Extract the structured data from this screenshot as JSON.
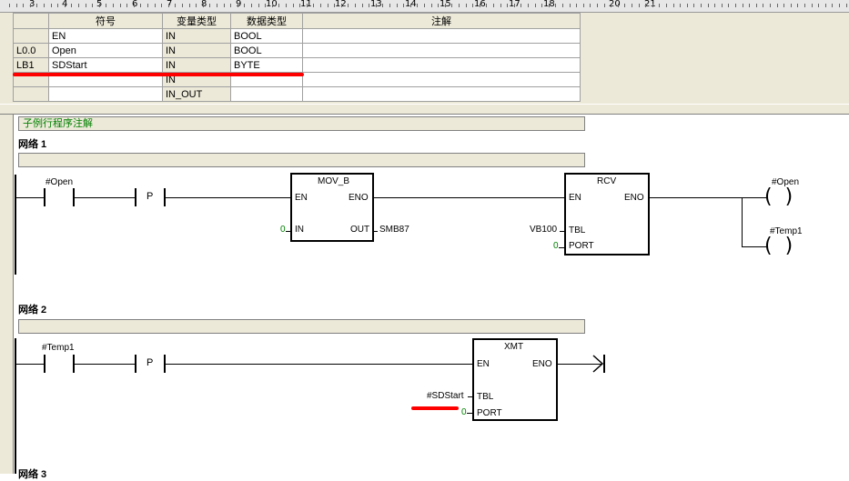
{
  "ruler": {
    "ticks": [
      "3",
      "4",
      "5",
      "6",
      "7",
      "8",
      "9",
      "10",
      "11",
      "12",
      "13",
      "14",
      "15",
      "16",
      "17",
      "18",
      "20",
      "21"
    ]
  },
  "var_table": {
    "headers": {
      "symbol": "符号",
      "var_type": "变量类型",
      "data_type": "数据类型",
      "comment": "注解"
    },
    "rows": [
      {
        "addr": "",
        "symbol": "EN",
        "var_type": "IN",
        "data_type": "BOOL",
        "comment": ""
      },
      {
        "addr": "L0.0",
        "symbol": "Open",
        "var_type": "IN",
        "data_type": "BOOL",
        "comment": ""
      },
      {
        "addr": "LB1",
        "symbol": "SDStart",
        "var_type": "IN",
        "data_type": "BYTE",
        "comment": ""
      },
      {
        "addr": "",
        "symbol": "",
        "var_type": "IN",
        "data_type": "",
        "comment": ""
      },
      {
        "addr": "",
        "symbol": "",
        "var_type": "IN_OUT",
        "data_type": "",
        "comment": ""
      }
    ]
  },
  "program": {
    "comment": "子例行程序注解"
  },
  "network1": {
    "title": "网络 1",
    "contact": "#Open",
    "p_label": "P",
    "mov": {
      "name": "MOV_B",
      "en": "EN",
      "eno": "ENO",
      "in": "IN",
      "out": "OUT",
      "in_val": "0",
      "out_val": "SMB87"
    },
    "rcv": {
      "name": "RCV",
      "en": "EN",
      "eno": "ENO",
      "tbl": "TBL",
      "port": "PORT",
      "tbl_val": "VB100",
      "port_val": "0"
    },
    "coil1": "#Open",
    "coil2": "#Temp1"
  },
  "network2": {
    "title": "网络 2",
    "contact": "#Temp1",
    "p_label": "P",
    "xmt": {
      "name": "XMT",
      "en": "EN",
      "eno": "ENO",
      "tbl": "TBL",
      "port": "PORT",
      "tbl_val": "#SDStart",
      "port_val": "0"
    }
  },
  "network3": {
    "title": "网络 3"
  },
  "colors": {
    "annotation": "#ff0000",
    "comment_text": "#008000"
  }
}
